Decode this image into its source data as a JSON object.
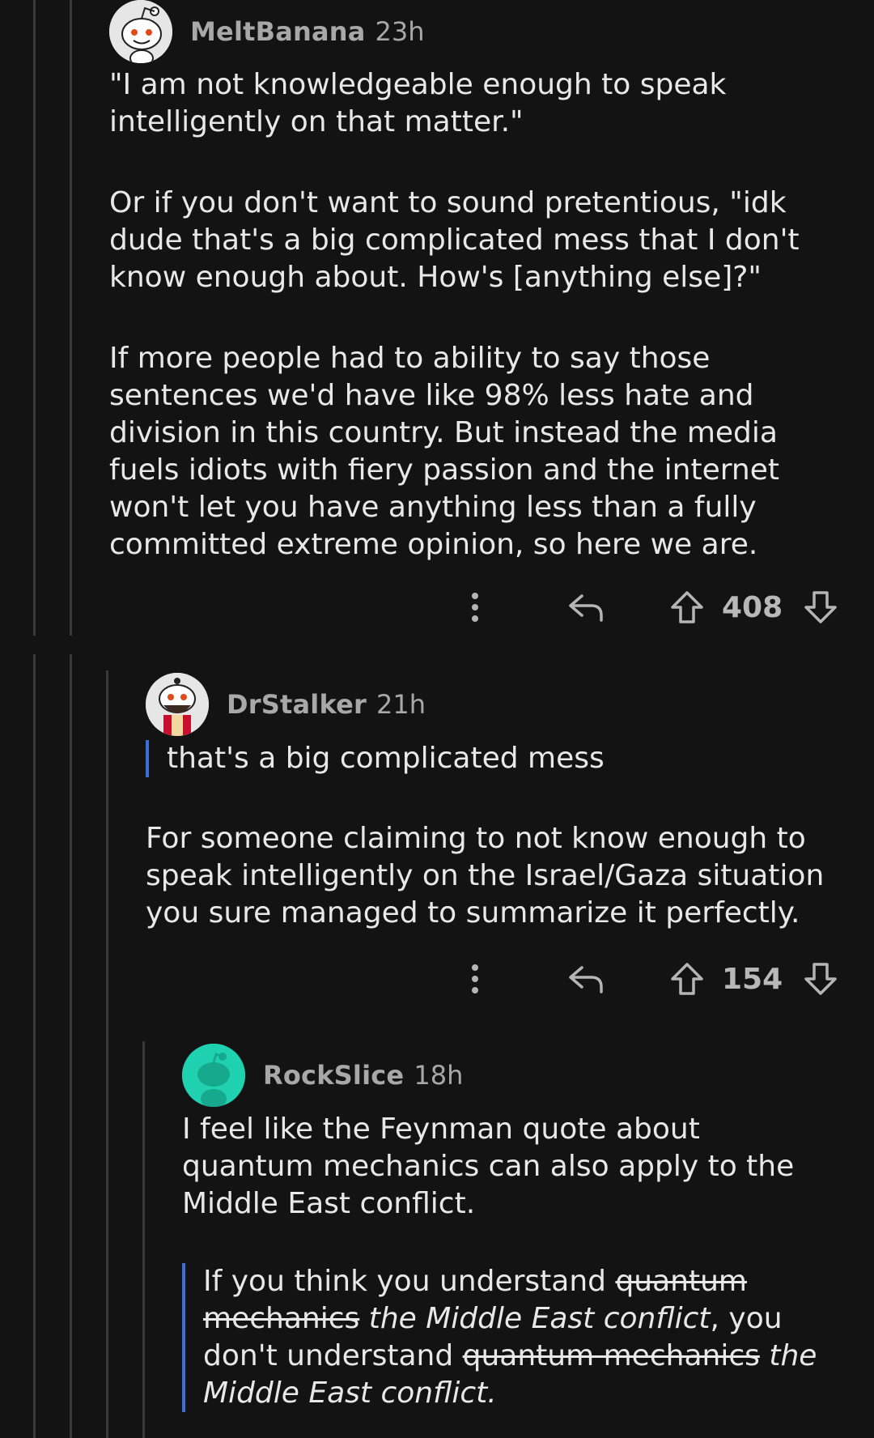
{
  "comments": [
    {
      "username": "MeltBanana",
      "age": "23h",
      "paragraphs": [
        "\"I am not knowledgeable enough to speak intelligently on that matter.\"",
        "Or if you don't want to sound pretentious, \"idk dude that's a big complicated mess that I don't know enough about. How's [anything else]?\"",
        "If more people had to ability to say those sentences we'd have like 98% less hate and division in this country. But instead the media fuels idiots with fiery passion and the internet won't let you have anything less than a fully committed extreme opinion, so here we are."
      ],
      "score": "408"
    },
    {
      "username": "DrStalker",
      "age": "21h",
      "quote": "that's a big complicated mess",
      "paragraphs": [
        "For someone claiming to not know enough to speak intelligently on the  Israel/Gaza situation you sure managed to summarize it perfectly."
      ],
      "score": "154"
    },
    {
      "username": "RockSlice",
      "age": "18h",
      "paragraphs": [
        "I feel like the Feynman quote about quantum mechanics can also apply to the Middle East conflict."
      ],
      "quote_parts": {
        "p1": "If you think you understand ",
        "strike1": "quantum mechanics",
        "ital1": "the Middle East conflict",
        "p2": ", you don't understand ",
        "strike2": "quantum mechanics",
        "ital2": "the Middle East conflict",
        "p3": "."
      }
    }
  ],
  "icons": {
    "more": "more-vertical-icon",
    "reply": "reply-arrow-icon",
    "upvote": "upvote-arrow-icon",
    "downvote": "downvote-arrow-icon"
  },
  "colors": {
    "background": "#131313",
    "quote_bar": "#3b6fd4",
    "rockslice_avatar": "#1fd1b0"
  }
}
